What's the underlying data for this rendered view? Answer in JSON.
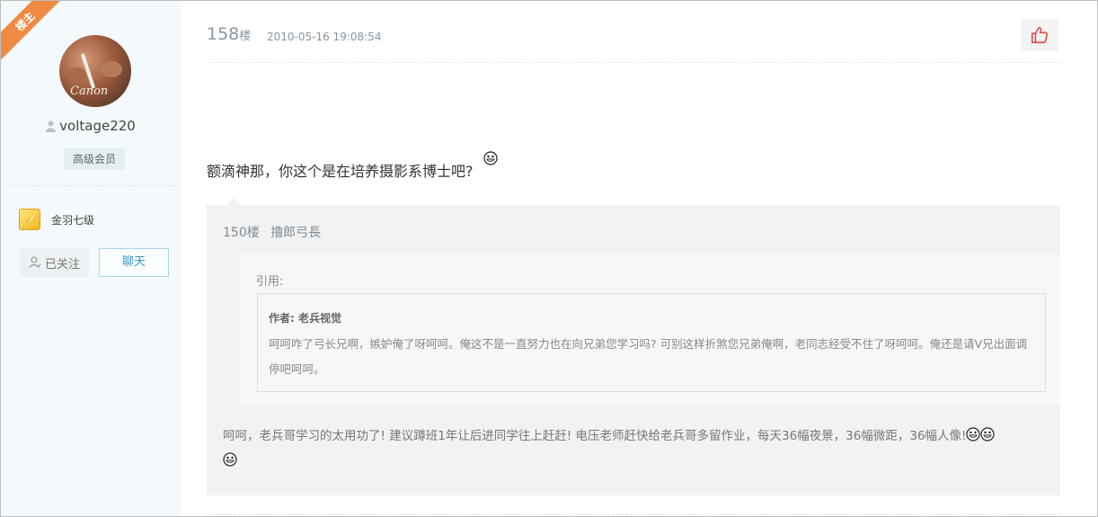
{
  "user": {
    "badge": "楼主",
    "name": "voltage220",
    "member_level": "高级会员",
    "rank_label": "金羽七级",
    "follow_label": "已关注",
    "chat_label": "聊天"
  },
  "post": {
    "floor": "158",
    "floor_suffix": "楼",
    "timestamp": "2010-05-16 19:08:54",
    "body": "额滴神那，你这个是在培养摄影系博士吧?"
  },
  "reply": {
    "floor": "150楼",
    "author": "撸郎弓長",
    "quote_title": "引用:",
    "quote_author": "作者: 老兵视觉",
    "quote_text": "呵呵咋了弓长兄啊，嫉妒俺了呀呵呵。俺这不是一直努力也在向兄弟您学习吗? 可别这样折煞您兄弟俺啊，老同志经受不住了呀呵呵。俺还是请V兄出面调停吧呵呵。",
    "text": "呵呵，老兵哥学习的太用功了! 建议蹲班1年让后进同学往上赶赶! 电压老师赶快给老兵哥多留作业，每天36幅夜景，36幅微距，36幅人像!"
  },
  "colors": {
    "ribbon": "#f08a43",
    "sidebar_bg": "#f4f9fb",
    "chat_accent": "#3a98c4",
    "like_icon": "#d9534f"
  }
}
